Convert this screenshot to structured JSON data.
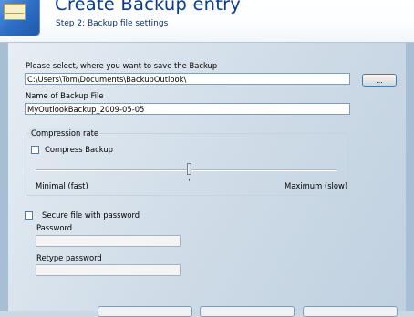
{
  "header": {
    "title": "Create Backup entry",
    "subtitle": "Step 2: Backup file settings"
  },
  "location": {
    "label": "Please select, where you want to save the Backup",
    "path": "C:\\Users\\Tom\\Documents\\BackupOutlook\\",
    "browse_label": "..."
  },
  "filename": {
    "label": "Name of Backup File",
    "value": "MyOutlookBackup_2009-05-05"
  },
  "compression": {
    "group_title": "Compression rate",
    "compress_label": "Compress Backup",
    "compress_checked": false,
    "min_label": "Minimal (fast)",
    "max_label": "Maximum (slow)",
    "level": 0.5
  },
  "security": {
    "secure_label": "Secure file with password",
    "secure_checked": false,
    "password_label": "Password",
    "retype_label": "Retype password"
  }
}
